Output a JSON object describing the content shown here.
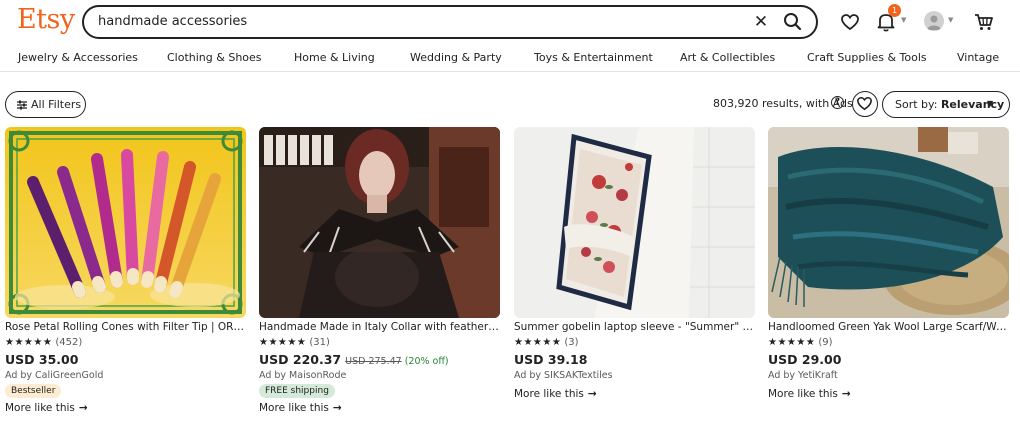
{
  "header": {
    "logo": "Etsy",
    "search_value": "handmade accessories",
    "notification_count": "1"
  },
  "categories": [
    "Jewelry & Accessories",
    "Clothing & Shoes",
    "Home & Living",
    "Wedding & Party",
    "Toys & Entertainment",
    "Art & Collectibles",
    "Craft Supplies & Tools",
    "Vintage"
  ],
  "toolbar": {
    "filters_label": "All Filters",
    "results_text": "803,920 results, with Ads",
    "sort_prefix": "Sort by: ",
    "sort_value": "Relevancy"
  },
  "products": [
    {
      "title": "Rose Petal Rolling Cones with Filter Tip | ORGANIC",
      "stars": "★★★★★",
      "reviews": "(452)",
      "price": "USD 35.00",
      "original_price": "",
      "discount": "",
      "ad_by": "Ad by CaliGreenGold",
      "badge": "Bestseller",
      "more": "More like this"
    },
    {
      "title": "Handmade Made in Italy Collar with feathers of leather",
      "stars": "★★★★★",
      "reviews": "(31)",
      "price": "USD 220.37",
      "original_price": "USD 275.47",
      "discount": "(20% off)",
      "ad_by": "Ad by MaisonRode",
      "badge": "FREE shipping",
      "more": "More like this"
    },
    {
      "title": "Summer gobelin laptop sleeve - \"Summer\" - Gobelin",
      "stars": "★★★★★",
      "reviews": "(3)",
      "price": "USD 39.18",
      "original_price": "",
      "discount": "",
      "ad_by": "Ad by SIKSAKTextiles",
      "badge": "",
      "more": "More like this"
    },
    {
      "title": "Handloomed Green Yak Wool Large Scarf/Wrap/Shawl",
      "stars": "★★★★★",
      "reviews": "(9)",
      "price": "USD 29.00",
      "original_price": "",
      "discount": "",
      "ad_by": "Ad by YetiKraft",
      "badge": "",
      "more": "More like this"
    }
  ],
  "colors": {
    "brand": "#f1641e",
    "text": "#222222",
    "discount": "#258635",
    "bestseller_bg": "#fdebd2",
    "freeship_bg": "#d4e9d7"
  }
}
